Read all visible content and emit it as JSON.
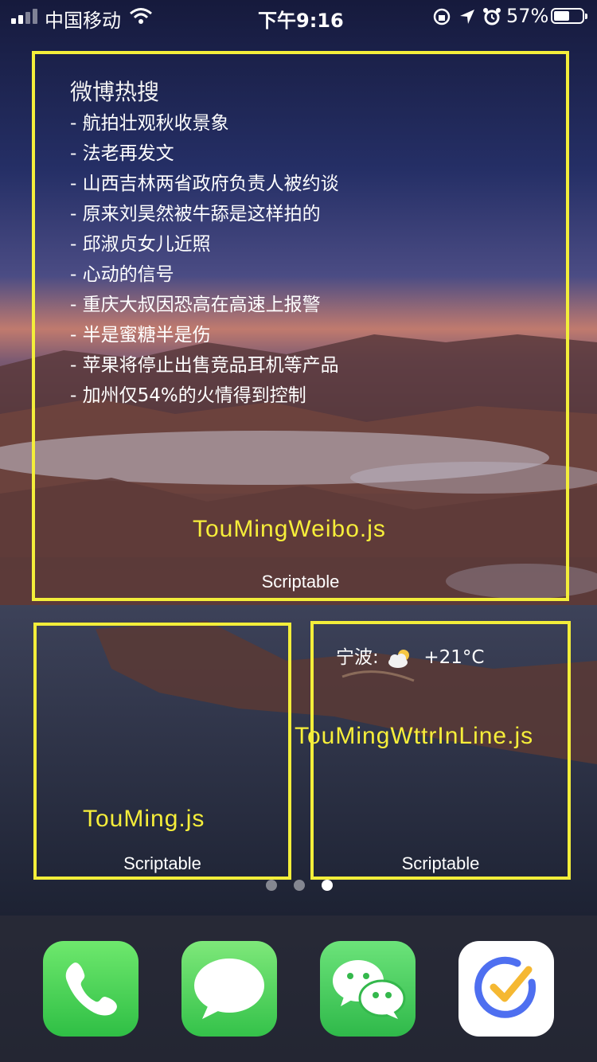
{
  "status_bar": {
    "carrier": "中国移动",
    "time": "下午9:16",
    "battery": "57%",
    "battery_level": 0.57
  },
  "widgets": {
    "weibo": {
      "title": "微博热搜",
      "items": [
        "- 航拍壮观秋收景象",
        "- 法老再发文",
        "- 山西吉林两省政府负责人被约谈",
        "- 原来刘昊然被牛舔是这样拍的",
        "- 邱淑贞女儿近照",
        "- 心动的信号",
        "- 重庆大叔因恐高在高速上报警",
        "- 半是蜜糖半是伤",
        "- 苹果将停止出售竞品耳机等产品",
        "- 加州仅54%的火情得到控制"
      ],
      "script_name": "TouMingWeibo.js",
      "app_label": "Scriptable"
    },
    "touming": {
      "script_name": "TouMing.js",
      "app_label": "Scriptable"
    },
    "weather": {
      "city": "宁波:",
      "weather_icon": "partly-cloudy-icon",
      "temperature": "+21°C",
      "script_name": "TouMingWttrInLine.js",
      "app_label": "Scriptable"
    }
  },
  "page_dots": {
    "count": 3,
    "active": 3
  },
  "dock": {
    "apps": [
      {
        "name": "Phone",
        "icon": "phone-icon",
        "color": "#4cd964"
      },
      {
        "name": "Messages",
        "icon": "message-bubble-icon",
        "color": "#5ad35e"
      },
      {
        "name": "WeChat",
        "icon": "wechat-icon",
        "color": "#56c86a"
      },
      {
        "name": "TickTick",
        "icon": "check-circle-icon",
        "color": "#ffffff"
      }
    ]
  },
  "colors": {
    "widget_border": "#f3ee3a",
    "script_text": "#f6ee3a"
  }
}
